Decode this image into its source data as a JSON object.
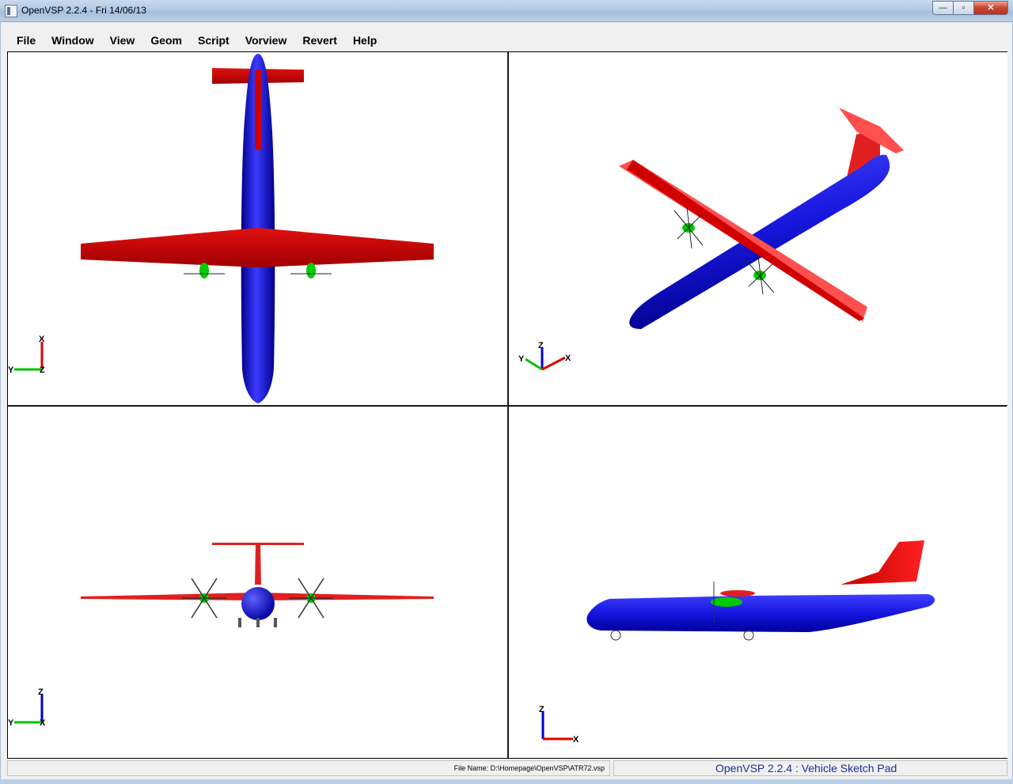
{
  "window": {
    "title": "OpenVSP 2.2.4 - Fri 14/06/13",
    "minimize_glyph": "—",
    "maximize_glyph": "▫",
    "close_glyph": "✕"
  },
  "menu": {
    "items": [
      {
        "label": "File"
      },
      {
        "label": "Window"
      },
      {
        "label": "View"
      },
      {
        "label": "Geom"
      },
      {
        "label": "Script"
      },
      {
        "label": "Vorview"
      },
      {
        "label": "Revert"
      },
      {
        "label": "Help"
      }
    ]
  },
  "viewports": {
    "top": {
      "axes": {
        "vertical": "X",
        "horizontal": "Y",
        "corner": "Z"
      }
    },
    "iso": {
      "axes": {
        "up": "Z",
        "left": "Y",
        "right": "X"
      }
    },
    "front": {
      "axes": {
        "vertical": "Z",
        "horizontal": "Y",
        "corner": "X"
      }
    },
    "side": {
      "axes": {
        "vertical": "Z",
        "horizontal": "X"
      }
    }
  },
  "status": {
    "file_label": "File Name:  D:\\Homepage\\OpenVSP\\ATR72.vsp",
    "app_banner": "OpenVSP 2.2.4 : Vehicle Sketch Pad"
  },
  "colors": {
    "fuselage": "#1010e0",
    "wing": "#d00000",
    "nacelle": "#00cc00",
    "axis_x": "#e00000",
    "axis_y": "#00c000",
    "axis_z": "#0000d0",
    "title_text": "#000000",
    "banner_text": "#1c2f99"
  }
}
